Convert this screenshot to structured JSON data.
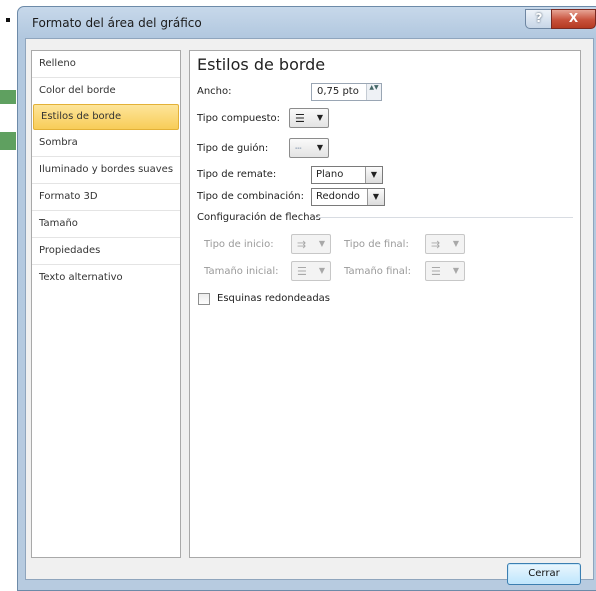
{
  "window": {
    "title": "Formato del área del gráfico",
    "help_glyph": "?",
    "close_glyph": "X"
  },
  "sidebar": {
    "items": [
      {
        "label": "Relleno"
      },
      {
        "label": "Color del borde"
      },
      {
        "label": "Estilos de borde",
        "selected": true
      },
      {
        "label": "Sombra"
      },
      {
        "label": "Iluminado y bordes suaves"
      },
      {
        "label": "Formato 3D"
      },
      {
        "label": "Tamaño"
      },
      {
        "label": "Propiedades"
      },
      {
        "label": "Texto alternativo"
      }
    ]
  },
  "panel": {
    "heading": "Estilos de borde",
    "width": {
      "label": "Ancho:",
      "value": "0,75 pto"
    },
    "compound": {
      "label": "Tipo compuesto:",
      "glyph": "☰"
    },
    "dash": {
      "label": "Tipo de guión:",
      "glyph": "┄"
    },
    "cap": {
      "label": "Tipo de remate:",
      "value": "Plano"
    },
    "join": {
      "label": "Tipo de combinación:",
      "value": "Redondo"
    },
    "arrows": {
      "section_label": "Configuración de flechas",
      "begin_type_label": "Tipo de inicio:",
      "end_type_label": "Tipo de final:",
      "begin_size_label": "Tamaño inicial:",
      "end_size_label": "Tamaño final:",
      "arrow_glyph": "⇉",
      "size_glyph": "☰"
    },
    "rounded_corners": {
      "label": "Esquinas redondeadas",
      "checked": false
    }
  },
  "footer": {
    "close_label": "Cerrar"
  },
  "icons": {
    "dropdown_arrow": "▼",
    "spin_arrows": "▲▼"
  },
  "colors": {
    "selection": "#f8cd58",
    "title_gradient": "#b2c8df",
    "close_button": "#c8523c"
  }
}
